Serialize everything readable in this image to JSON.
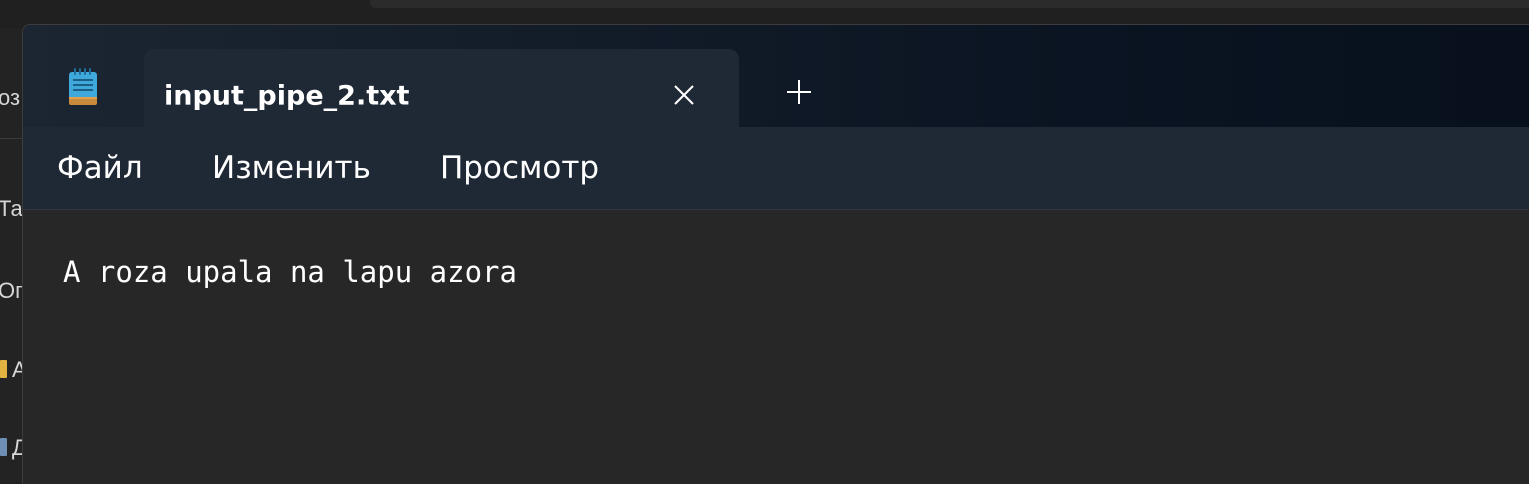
{
  "background_window": {
    "sidebar_text": [
      "оз",
      "Та",
      "Ог",
      "А",
      "Д"
    ]
  },
  "window": {
    "tab": {
      "title": "input_pipe_2.txt",
      "close_icon": "close-icon"
    },
    "new_tab_icon": "plus-icon",
    "app_icon": "notepad-icon"
  },
  "menu": {
    "file": "Файл",
    "edit": "Изменить",
    "view": "Просмотр"
  },
  "editor": {
    "content": "A roza upala na lapu azora"
  },
  "colors": {
    "accent": "#4cc2ff",
    "titlebar": "#0b1422",
    "editor_bg": "#272727"
  }
}
